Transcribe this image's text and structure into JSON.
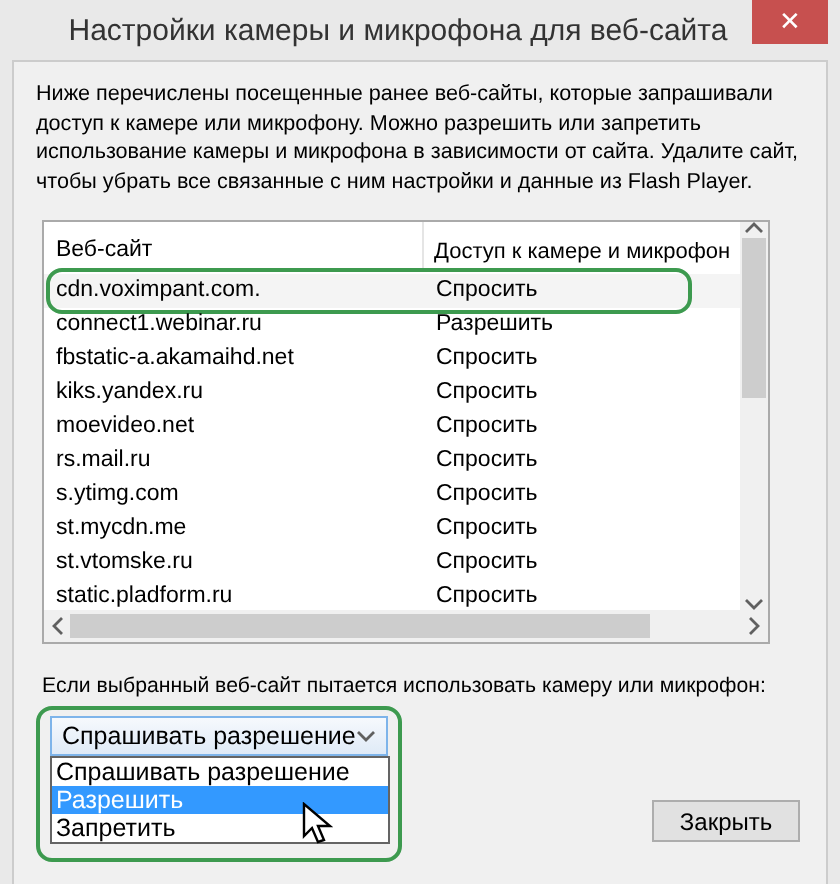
{
  "window": {
    "title": "Настройки камеры и микрофона для веб-сайта",
    "close": "✕"
  },
  "description": "Ниже перечислены посещенные ранее веб-сайты, которые запрашивали доступ к камере или микрофону. Можно разрешить или запретить использование камеры и микрофона в зависимости от сайта. Удалите сайт, чтобы убрать все связанные с ним настройки и данные из Flash Player.",
  "table": {
    "columns": [
      "Веб-сайт",
      "Доступ к камере и микрофон"
    ],
    "rows": [
      {
        "site": "cdn.voximpant.com.",
        "access": "Спросить",
        "selected": true,
        "highlighted": true
      },
      {
        "site": "connect1.webinar.ru",
        "access": "Разрешить",
        "selected": false,
        "highlighted": false
      },
      {
        "site": "fbstatic-a.akamaihd.net",
        "access": "Спросить",
        "selected": false,
        "highlighted": false
      },
      {
        "site": "kiks.yandex.ru",
        "access": "Спросить",
        "selected": false,
        "highlighted": false
      },
      {
        "site": "moevideo.net",
        "access": "Спросить",
        "selected": false,
        "highlighted": false
      },
      {
        "site": "rs.mail.ru",
        "access": "Спросить",
        "selected": false,
        "highlighted": false
      },
      {
        "site": "s.ytimg.com",
        "access": "Спросить",
        "selected": false,
        "highlighted": false
      },
      {
        "site": "st.mycdn.me",
        "access": "Спросить",
        "selected": false,
        "highlighted": false
      },
      {
        "site": "st.vtomske.ru",
        "access": "Спросить",
        "selected": false,
        "highlighted": false
      },
      {
        "site": "static.pladform.ru",
        "access": "Спросить",
        "selected": false,
        "highlighted": false
      }
    ]
  },
  "policy": {
    "label": "Если выбранный веб-сайт пытается использовать камеру или микрофон:",
    "value": "Спрашивать разрешение",
    "expanded": true,
    "highlighted": true,
    "options": [
      {
        "label": "Спрашивать разрешение",
        "hovered": false
      },
      {
        "label": "Разрешить",
        "hovered": true
      },
      {
        "label": "Запретить",
        "hovered": false
      }
    ]
  },
  "buttons": [
    "Закрыть"
  ]
}
